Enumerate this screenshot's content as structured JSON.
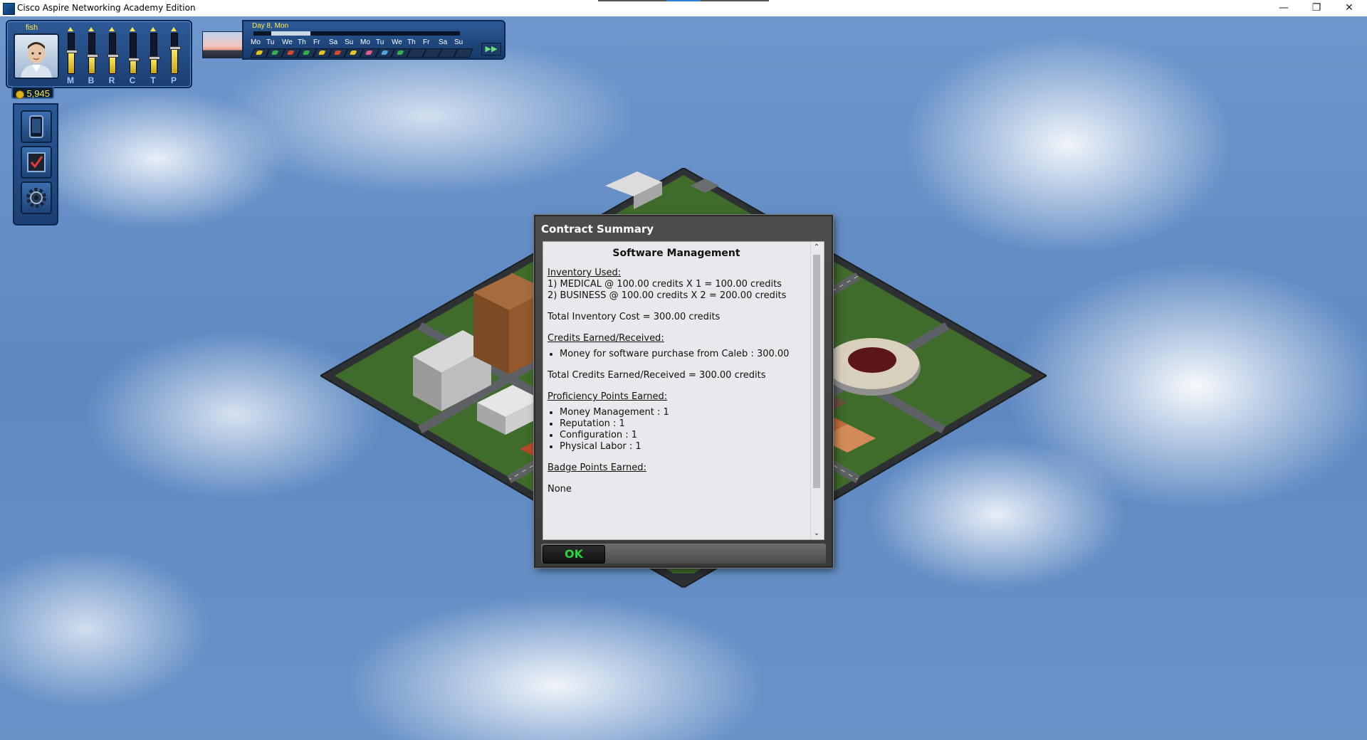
{
  "window": {
    "title": "Cisco Aspire Networking Academy Edition",
    "minimize_glyph": "—",
    "restore_glyph": "❐",
    "close_glyph": "✕"
  },
  "hud": {
    "player_name": "fish",
    "credits": "5,945",
    "meters": [
      {
        "label": "M",
        "level": 0.55
      },
      {
        "label": "B",
        "level": 0.45
      },
      {
        "label": "R",
        "level": 0.45
      },
      {
        "label": "C",
        "level": 0.35
      },
      {
        "label": "T",
        "level": 0.4
      },
      {
        "label": "P",
        "level": 0.65
      }
    ],
    "tools": [
      {
        "icon": "phone-icon"
      },
      {
        "icon": "checklist-icon"
      },
      {
        "icon": "gear-icon"
      }
    ]
  },
  "calendar": {
    "day_label": "Day 8, Mon",
    "days": [
      "Mo",
      "Tu",
      "We",
      "Th",
      "Fr",
      "Sa",
      "Su",
      "Mo",
      "Tu",
      "We",
      "Th",
      "Fr",
      "Sa",
      "Su"
    ],
    "fast_forward": "▶▶"
  },
  "dialog": {
    "title": "Contract Summary",
    "heading": "Software Management",
    "inventory_header": "Inventory Used:",
    "inventory_lines": [
      "1) MEDICAL @ 100.00 credits X 1 = 100.00 credits",
      "2) BUSINESS @ 100.00 credits X 2 = 200.00 credits"
    ],
    "total_inventory": "Total Inventory Cost = 300.00 credits",
    "credits_header": "Credits Earned/Received:",
    "credits_items": [
      "Money for software purchase from Caleb : 300.00"
    ],
    "total_credits": "Total Credits Earned/Received = 300.00 credits",
    "proficiency_header": "Proficiency Points Earned:",
    "proficiency_items": [
      "Money Management : 1",
      "Reputation : 1",
      "Configuration : 1",
      "Physical Labor : 1"
    ],
    "badge_header": "Badge Points Earned:",
    "badge_value": "None",
    "ok_label": "OK",
    "scroll_up": "⌃",
    "scroll_down": "⌄"
  },
  "colors": {
    "accent_yellow": "#ffe84a",
    "ok_green": "#2bd43b",
    "hud_blue": "#2c5a97"
  }
}
